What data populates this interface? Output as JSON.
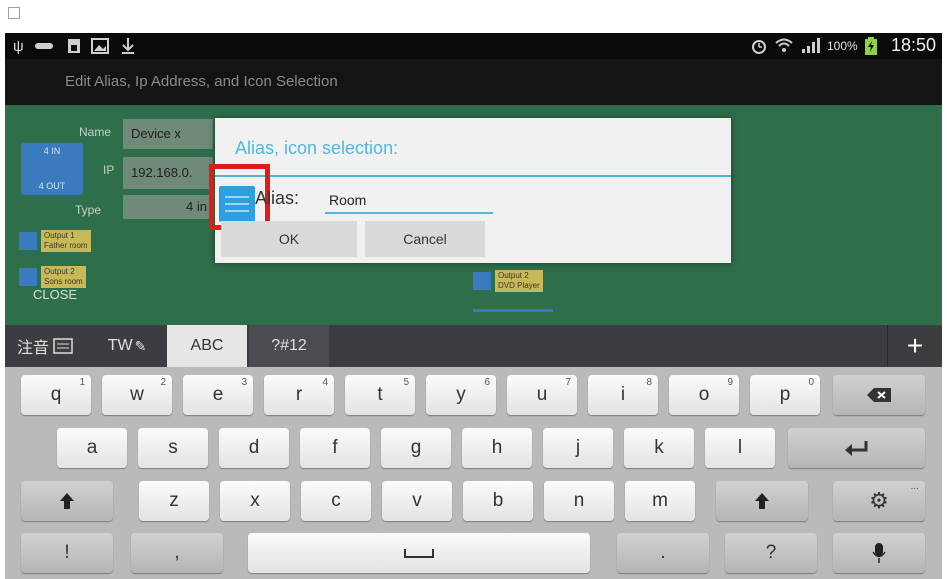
{
  "status_bar": {
    "left_icons": [
      "usb-icon",
      "voicemail-icon",
      "sim-icon",
      "image-icon",
      "download-icon"
    ],
    "right_icons": [
      "alarm-icon",
      "wifi-icon",
      "signal-icon",
      "battery-icon"
    ],
    "battery": "100%",
    "time": "18:50"
  },
  "action_bar": {
    "title": "Edit Alias, Ip Address, and Icon Selection"
  },
  "background_form": {
    "device_icon_top": "4 IN",
    "device_icon_bottom": "4 OUT",
    "name_label": "Name",
    "name_value": "Device x",
    "ip_label": "IP",
    "ip_value": "192.168.0.",
    "type_label": "Type",
    "type_value": "4 in",
    "outputs": [
      {
        "label": "Output 1",
        "sub": "Father room"
      },
      {
        "label": "Output 2",
        "sub": "Sons room"
      },
      {
        "label": "Output 2",
        "sub": "DVD Player"
      }
    ],
    "close_label": "CLOSE"
  },
  "dialog": {
    "title": "Alias, icon selection:",
    "alias_label": "Alias:",
    "alias_value": "Room",
    "ok_label": "OK",
    "cancel_label": "Cancel"
  },
  "keyboard": {
    "modes": [
      "注音",
      "TW",
      "ABC",
      "?#12"
    ],
    "active_mode": "ABC",
    "plus_label": "+",
    "row1": [
      {
        "k": "q",
        "n": "1"
      },
      {
        "k": "w",
        "n": "2"
      },
      {
        "k": "e",
        "n": "3"
      },
      {
        "k": "r",
        "n": "4"
      },
      {
        "k": "t",
        "n": "5"
      },
      {
        "k": "y",
        "n": "6"
      },
      {
        "k": "u",
        "n": "7"
      },
      {
        "k": "i",
        "n": "8"
      },
      {
        "k": "o",
        "n": "9"
      },
      {
        "k": "p",
        "n": "0"
      }
    ],
    "row2": [
      "a",
      "s",
      "d",
      "f",
      "g",
      "h",
      "j",
      "k",
      "l"
    ],
    "row3": [
      "z",
      "x",
      "c",
      "v",
      "b",
      "n",
      "m"
    ],
    "row4": {
      "excl": "!",
      "comma": ",",
      "period": ".",
      "question": "?"
    },
    "settings_badge": "..."
  },
  "colors": {
    "accent": "#4fb8dc",
    "highlight": "#e11a1a",
    "app_background": "#2f6e4a"
  }
}
